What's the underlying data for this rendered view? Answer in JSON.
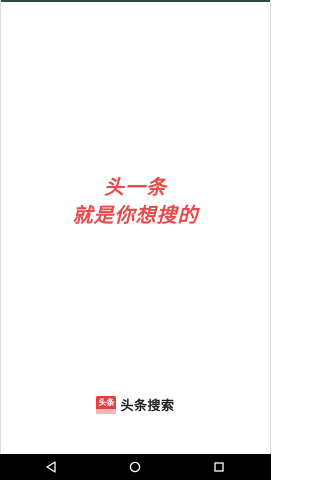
{
  "splash": {
    "slogan_line1": "头一条",
    "slogan_line2": "就是你想搜的"
  },
  "brand": {
    "logo_text": "头条",
    "name": "头条搜索"
  },
  "navbar": {
    "back_icon": "back-triangle-icon",
    "home_icon": "home-circle-icon",
    "recent_icon": "recents-square-icon"
  },
  "colors": {
    "accent": "#e84a4e",
    "logo_bg": "#e3403f",
    "navbar_bg": "#000000"
  }
}
